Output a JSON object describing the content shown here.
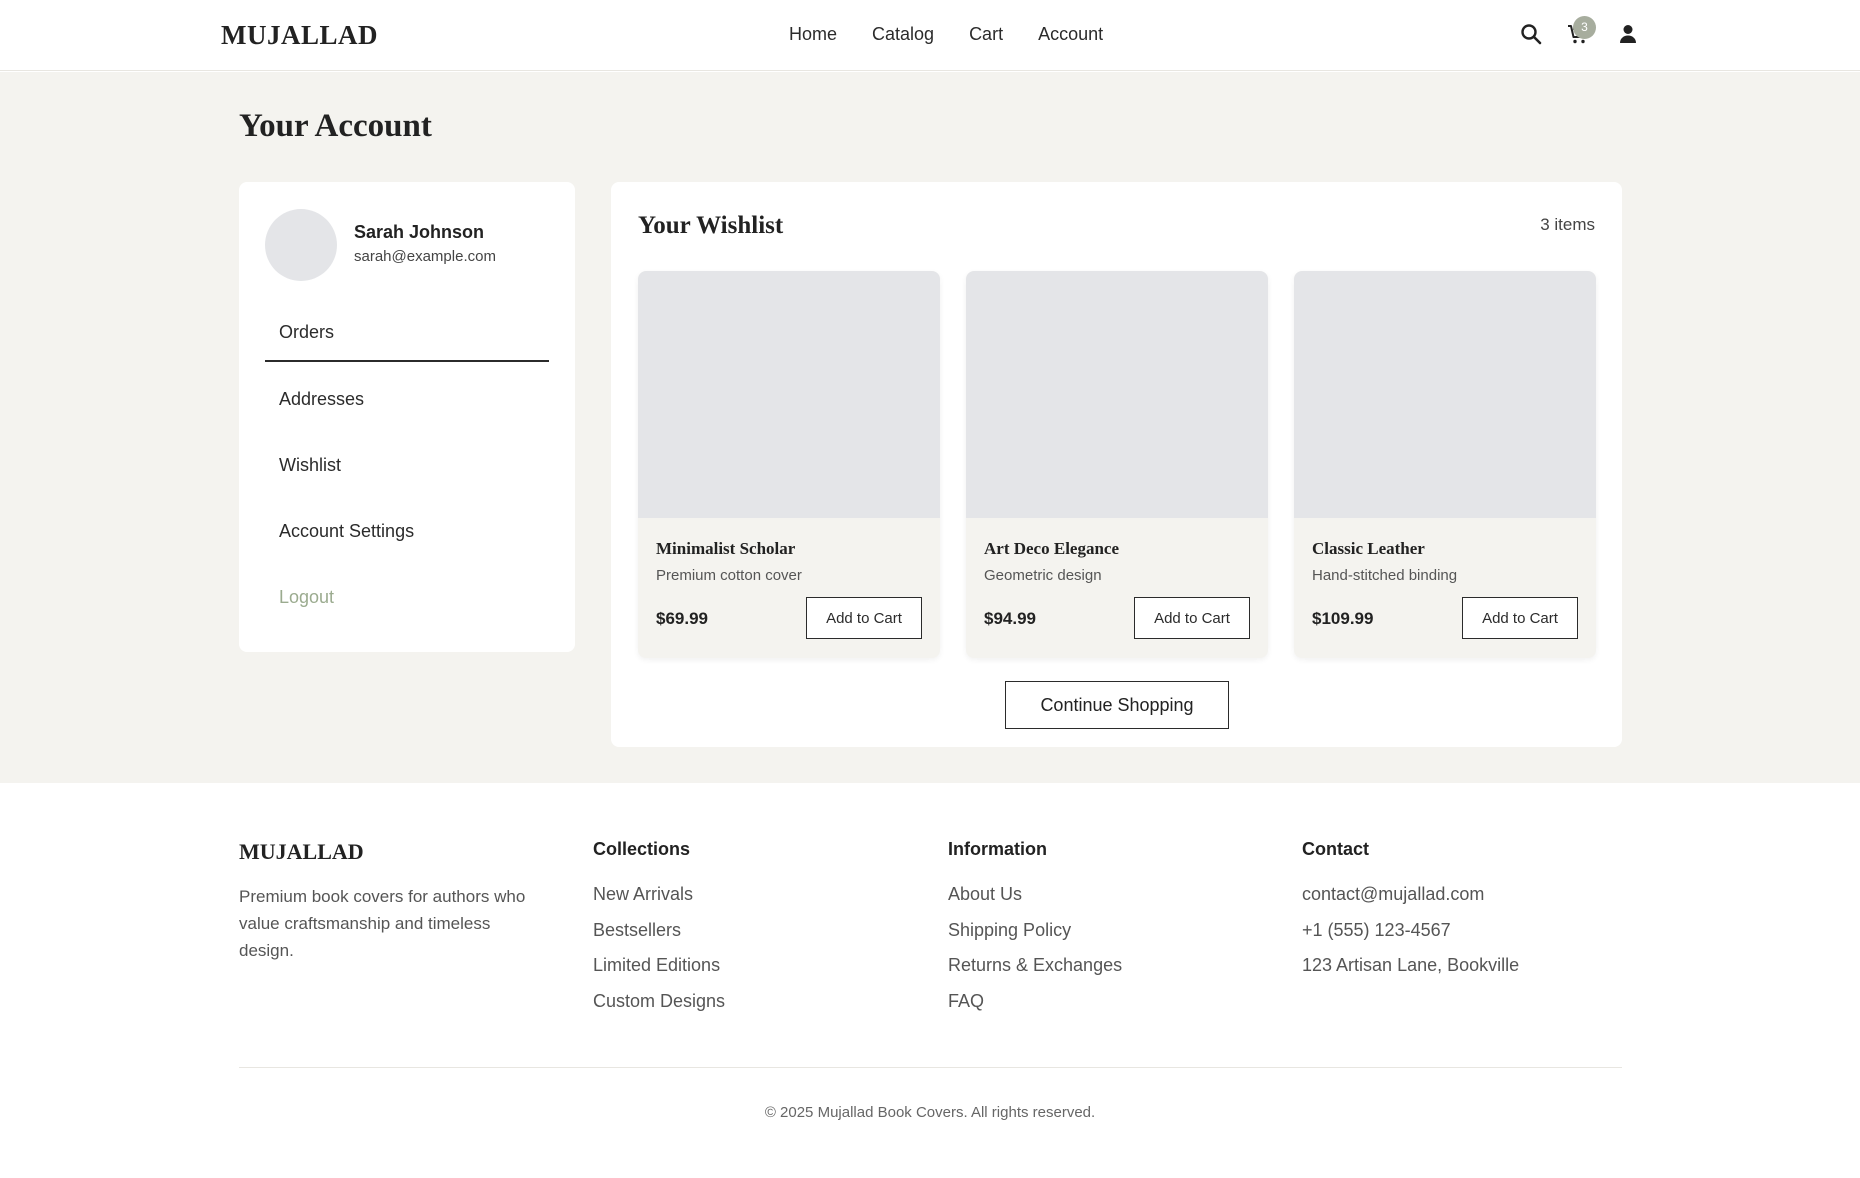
{
  "header": {
    "logo": "MUJALLAD",
    "nav": [
      "Home",
      "Catalog",
      "Cart",
      "Account"
    ],
    "cart_count": "3",
    "icons": [
      "search-icon",
      "cart-icon",
      "user-icon"
    ]
  },
  "page": {
    "title": "Your Account"
  },
  "sidebar": {
    "user_name": "Sarah Johnson",
    "user_email": "sarah@example.com",
    "items": [
      {
        "label": "Orders"
      },
      {
        "label": "Addresses"
      },
      {
        "label": "Wishlist"
      },
      {
        "label": "Account Settings"
      },
      {
        "label": "Logout"
      }
    ]
  },
  "wishlist": {
    "title": "Your Wishlist",
    "count": "3 items",
    "products": [
      {
        "name": "Minimalist Scholar",
        "desc": "Premium cotton cover",
        "price": "$69.99",
        "button": "Add to Cart"
      },
      {
        "name": "Art Deco Elegance",
        "desc": "Geometric design",
        "price": "$94.99",
        "button": "Add to Cart"
      },
      {
        "name": "Classic Leather",
        "desc": "Hand-stitched binding",
        "price": "$109.99",
        "button": "Add to Cart"
      }
    ],
    "continue_label": "Continue Shopping"
  },
  "footer": {
    "logo": "MUJALLAD",
    "tagline": "Premium book covers for authors who value craftsmanship and timeless design.",
    "collections": {
      "title": "Collections",
      "links": [
        "New Arrivals",
        "Bestsellers",
        "Limited Editions",
        "Custom Designs"
      ]
    },
    "information": {
      "title": "Information",
      "links": [
        "About Us",
        "Shipping Policy",
        "Returns & Exchanges",
        "FAQ"
      ]
    },
    "contact": {
      "title": "Contact",
      "links": [
        "contact@mujallad.com",
        "+1 (555) 123-4567",
        "123 Artisan Lane, Bookville"
      ]
    },
    "copyright": "© 2025 Mujallad Book Covers. All rights reserved."
  },
  "colors": {
    "background": "#f4f3ef",
    "accent": "#9bab8f",
    "badge": "#a7ad9e",
    "placeholder": "#e4e5e8"
  }
}
